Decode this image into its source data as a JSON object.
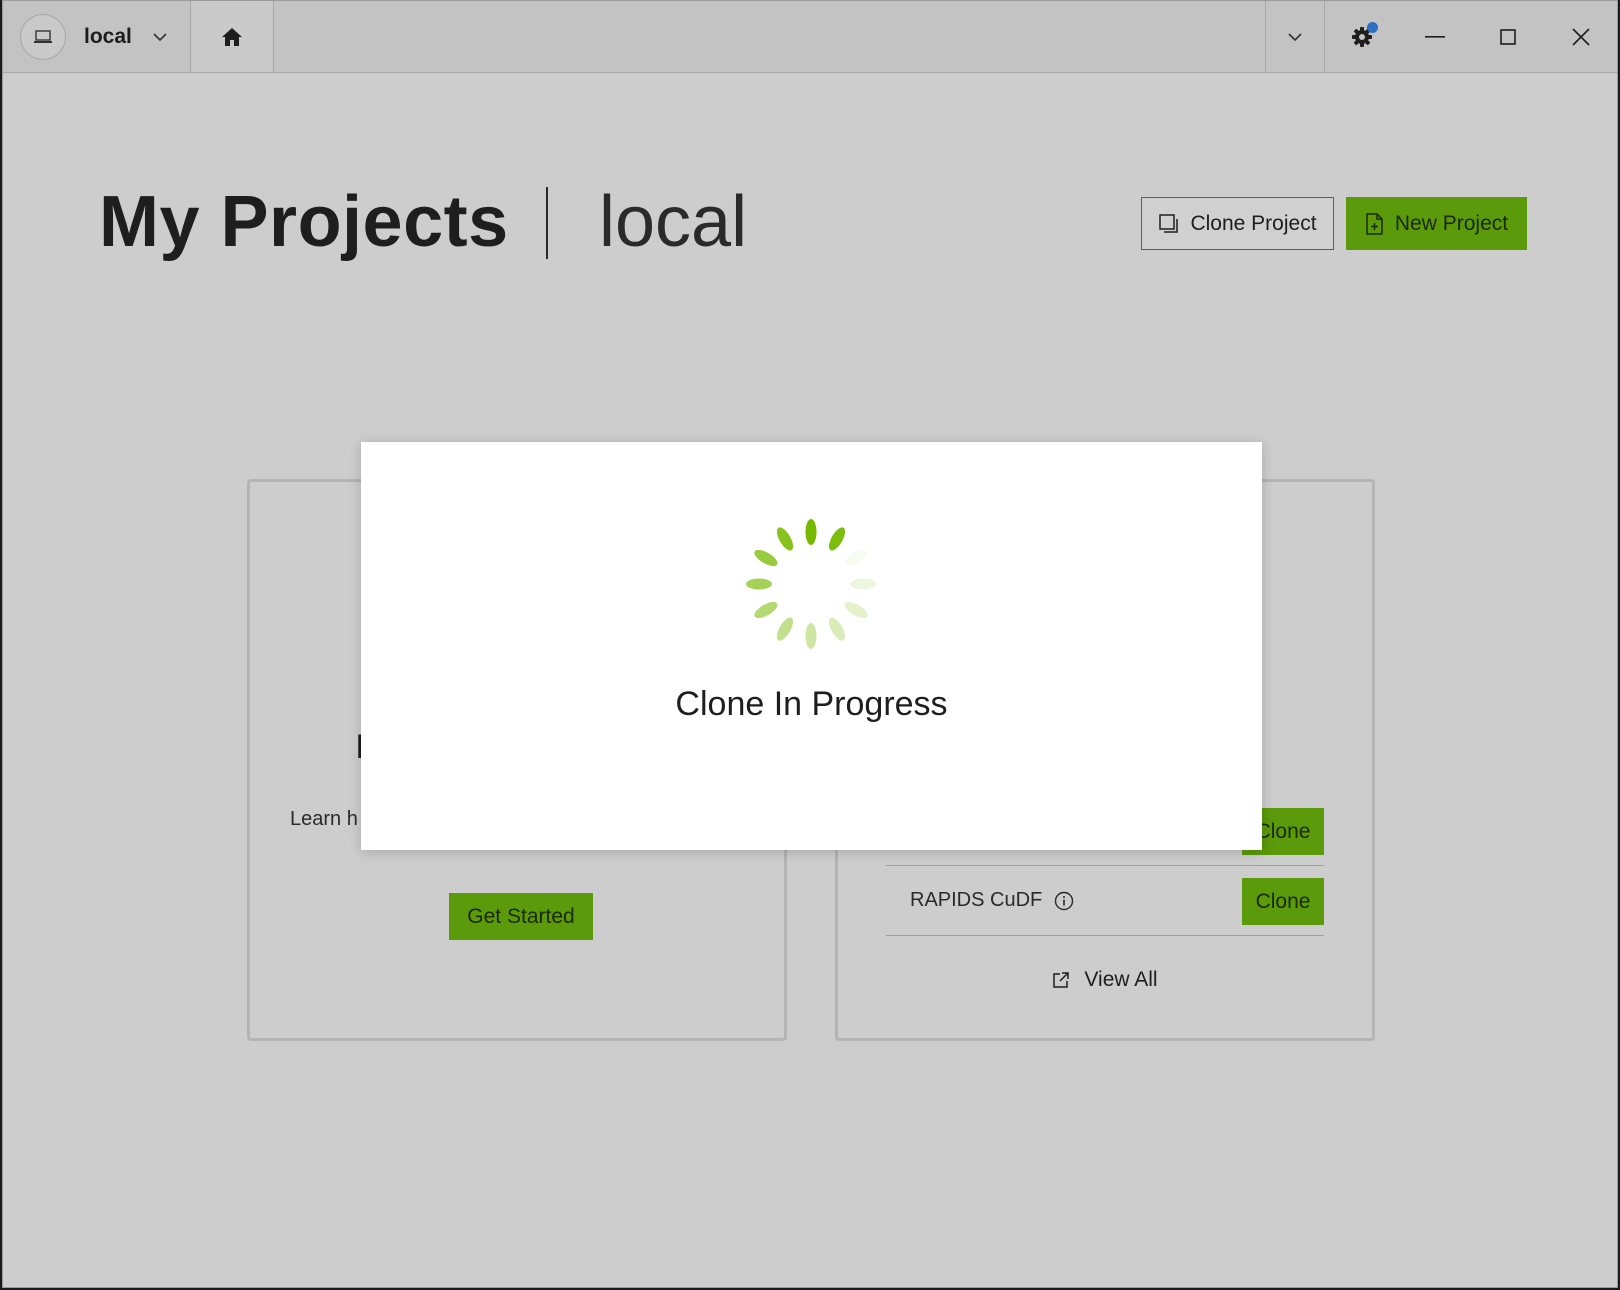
{
  "titlebar": {
    "context_label": "local"
  },
  "header": {
    "title": "My Projects",
    "context": "local",
    "clone_project_label": "Clone Project",
    "new_project_label": "New Project"
  },
  "left_card": {
    "heading": "I",
    "text": "Learn h",
    "button_label": "Get Started"
  },
  "right_card": {
    "rows": [
      {
        "name": "",
        "button_label": "Clone"
      },
      {
        "name": "RAPIDS CuDF",
        "button_label": "Clone"
      }
    ],
    "view_all_label": "View All"
  },
  "modal": {
    "title": "Clone In Progress"
  },
  "colors": {
    "accent": "#5b9a0a",
    "spinner": "#76b900",
    "notification": "#2d6fbf"
  },
  "icons": {
    "context": "laptop-icon",
    "home": "home-icon",
    "settings": "gear-icon",
    "clone": "copy-icon",
    "new": "new-file-icon",
    "info": "info-icon",
    "external": "external-link-icon"
  }
}
